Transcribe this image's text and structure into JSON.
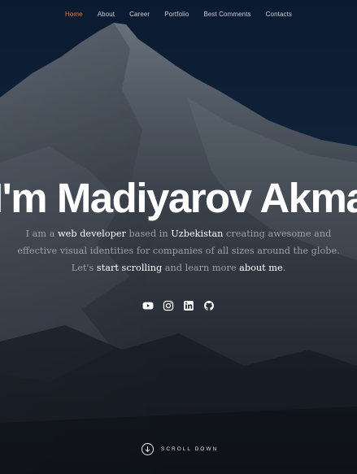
{
  "nav": {
    "items": [
      {
        "label": "Home",
        "active": true
      },
      {
        "label": "About"
      },
      {
        "label": "Career"
      },
      {
        "label": "Portfolio"
      },
      {
        "label": "Best Comments"
      },
      {
        "label": "Contacts"
      }
    ]
  },
  "hero": {
    "headline": "I'm Madiyarov Akmal",
    "intro": {
      "p1": "I am a ",
      "role": "web developer",
      "p2": " based in ",
      "location": "Uzbekistan",
      "p3": " creating awesome and effective visual identities for companies of all sizes around the globe. Let's ",
      "scroll_link": "start scrolling",
      "p4": " and learn more ",
      "about_link": "about me",
      "p5": "."
    },
    "social_icons": [
      "youtube-icon",
      "instagram-icon",
      "linkedin-icon",
      "github-icon"
    ],
    "scroll_down": "SCROLL DOWN"
  },
  "colors": {
    "accent": "#e57a3a",
    "text_highlight": "#ffffff",
    "text_muted": "#9aa1ab"
  }
}
